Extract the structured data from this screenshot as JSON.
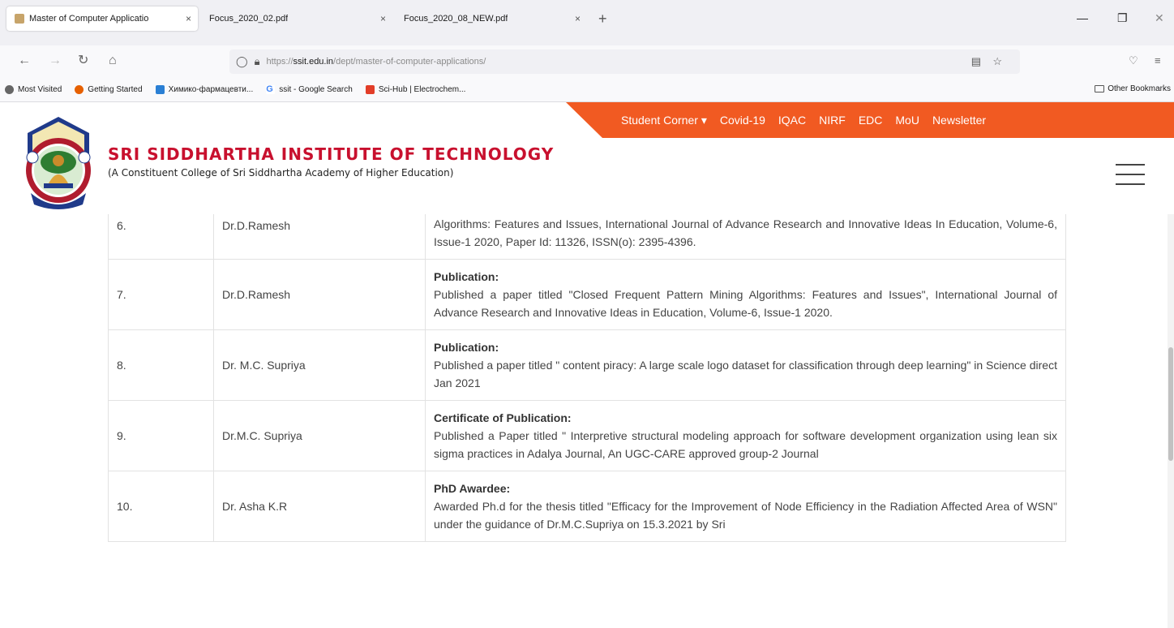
{
  "browser": {
    "tabs": [
      {
        "title": "Master of Computer Applicatio",
        "close": "×"
      },
      {
        "title": "Focus_2020_02.pdf",
        "close": "×"
      },
      {
        "title": "Focus_2020_08_NEW.pdf",
        "close": "×"
      }
    ],
    "new_tab": "+",
    "url_prefix": "https://",
    "url_domain": "ssit.edu.in",
    "url_path": "/dept/master-of-computer-applications/",
    "bookmarks": [
      {
        "label": "Most Visited",
        "color": "#666666"
      },
      {
        "label": "Getting Started",
        "color": "#e66000"
      },
      {
        "label": "Химико-фармацевти...",
        "color": "#2a7fd4"
      },
      {
        "label": "ssit - Google Search",
        "color": "#4285f4"
      },
      {
        "label": "Sci-Hub | Electrochem...",
        "color": "#e23d28"
      }
    ],
    "other_bookmarks": "Other Bookmarks"
  },
  "site": {
    "title": "SRI SIDDHARTHA INSTITUTE OF TECHNOLOGY",
    "subtitle": "(A Constituent College of Sri Siddhartha Academy of Higher Education)",
    "menu": [
      "Student Corner ▾",
      "Covid-19",
      "IQAC",
      "NIRF",
      "EDC",
      "MoU",
      "Newsletter"
    ],
    "accent_color": "#f15a22",
    "title_color": "#c8102e"
  },
  "table": {
    "rows": [
      {
        "sl": "6.",
        "name": "Dr.D.Ramesh",
        "heading": "",
        "text": "of Advance Research and Innovative Ideas in Education, Volume-6, Issue-1 2020 Closed Frequent Pattern Mining Algorithms: Features and Issues, International Journal of Advance Research and Innovative Ideas In Education, Volume-6, Issue-1 2020, Paper Id: 11326, ISSN(o): 2395-4396."
      },
      {
        "sl": "7.",
        "name": "Dr.D.Ramesh",
        "heading": "Publication:",
        "text": "Published a paper titled \"Closed Frequent Pattern Mining Algorithms: Features and Issues\", International Journal of Advance Research and Innovative Ideas in Education, Volume-6, Issue-1 2020."
      },
      {
        "sl": "8.",
        "name": "Dr. M.C. Supriya",
        "heading": "Publication:",
        "text": "Published a paper titled \" content piracy: A large scale logo dataset for classification through deep learning\" in Science direct Jan 2021"
      },
      {
        "sl": "9.",
        "name": "Dr.M.C. Supriya",
        "heading": "Certificate of Publication:",
        "text": "Published a Paper titled \" Interpretive structural modeling approach for software development organization using lean six sigma practices in Adalya Journal, An UGC-CARE approved group-2 Journal"
      },
      {
        "sl": "10.",
        "name": "Dr. Asha K.R",
        "heading": "PhD Awardee:",
        "text": "Awarded Ph.d for the thesis titled \"Efficacy for the Improvement of Node Efficiency in the Radiation Affected Area of WSN\" under the guidance of Dr.M.C.Supriya on 15.3.2021 by Sri"
      }
    ]
  }
}
